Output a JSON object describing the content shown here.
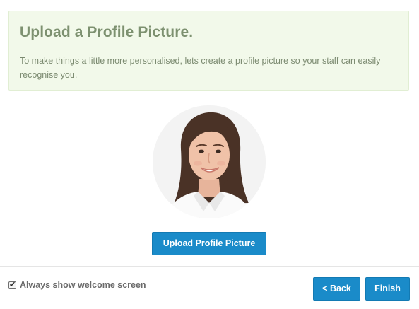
{
  "intro": {
    "title": "Upload a Profile Picture.",
    "text": "To make things a little more personalised, lets create a profile picture so your staff can easily recognise you."
  },
  "profile_picture": {
    "icon": "profile-photo",
    "alt": "Profile picture"
  },
  "upload_button": {
    "label": "Upload Profile Picture"
  },
  "footer": {
    "welcome_checkbox": {
      "label": "Always show welcome screen",
      "checked": true,
      "icon": "checkmark-icon"
    },
    "back_label": "< Back",
    "finish_label": "Finish"
  },
  "colors": {
    "panel_bg": "#f2f9ea",
    "title": "#7d9170",
    "primary_button": "#1a8bc9"
  }
}
